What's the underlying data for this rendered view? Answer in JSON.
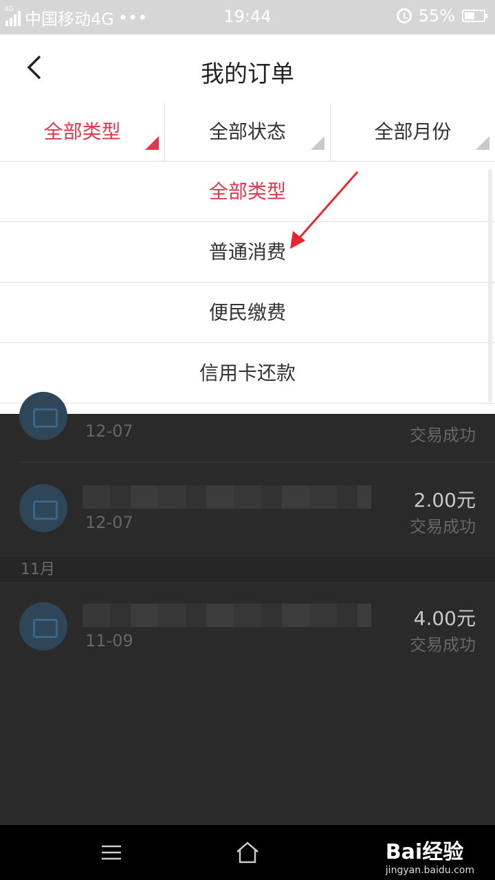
{
  "status_bar": {
    "carrier": "中国移动4G",
    "network_tag": "4G",
    "more": "•••",
    "time": "19:44",
    "battery": "55%"
  },
  "header": {
    "title": "我的订单"
  },
  "filters": [
    {
      "label": "全部类型",
      "active": true
    },
    {
      "label": "全部状态",
      "active": false
    },
    {
      "label": "全部月份",
      "active": false
    }
  ],
  "dropdown": {
    "options": [
      "全部类型",
      "普通消费",
      "便民缴费",
      "信用卡还款"
    ],
    "selected": "全部类型"
  },
  "orders": [
    {
      "date": "12-07",
      "amount": "",
      "status": "交易成功"
    },
    {
      "date": "12-07",
      "amount": "2.00元",
      "status": "交易成功"
    },
    {
      "date": "11-09",
      "amount": "4.00元",
      "status": "交易成功"
    }
  ],
  "month_header": "11月",
  "watermark": {
    "brand": "Bai经验",
    "url": "jingyan.baidu.com"
  },
  "colors": {
    "accent": "#e0384d",
    "overlay": "#2a2a2a"
  }
}
